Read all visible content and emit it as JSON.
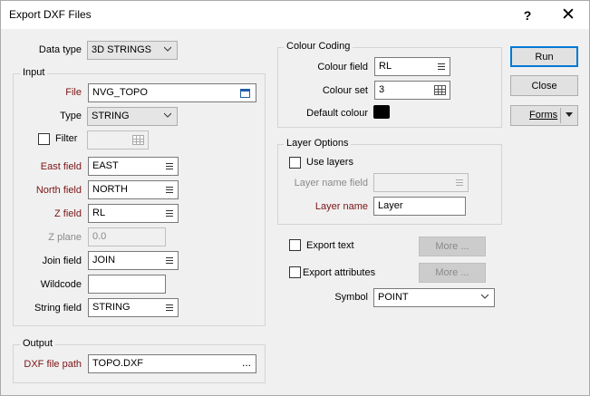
{
  "window": {
    "title": "Export DXF Files",
    "help": "?",
    "close": "✕"
  },
  "data_type": {
    "label": "Data type",
    "value": "3D STRINGS"
  },
  "input": {
    "title": "Input",
    "file": {
      "label": "File",
      "value": "NVG_TOPO"
    },
    "type": {
      "label": "Type",
      "value": "STRING"
    },
    "filter": {
      "label": "Filter",
      "value": ""
    },
    "east_field": {
      "label": "East field",
      "value": "EAST"
    },
    "north_field": {
      "label": "North field",
      "value": "NORTH"
    },
    "z_field": {
      "label": "Z field",
      "value": "RL"
    },
    "z_plane": {
      "label": "Z plane",
      "value": "0.0"
    },
    "join_field": {
      "label": "Join field",
      "value": "JOIN"
    },
    "wildcode": {
      "label": "Wildcode",
      "value": ""
    },
    "string_field": {
      "label": "String field",
      "value": "STRING"
    }
  },
  "output": {
    "title": "Output",
    "dxf_file_path": {
      "label": "DXF file path",
      "value": "TOPO.DXF",
      "browse": "..."
    }
  },
  "colour_coding": {
    "title": "Colour Coding",
    "colour_field": {
      "label": "Colour field",
      "value": "RL"
    },
    "colour_set": {
      "label": "Colour set",
      "value": "3"
    },
    "default_colour": {
      "label": "Default colour",
      "color": "#000000"
    }
  },
  "layer_options": {
    "title": "Layer Options",
    "use_layers": "Use layers",
    "layer_name_field": {
      "label": "Layer name field",
      "value": ""
    },
    "layer_name": {
      "label": "Layer name",
      "value": "Layer"
    }
  },
  "export_text": {
    "label": "Export text",
    "more": "More ..."
  },
  "export_attributes": {
    "label": "Export attributes",
    "more": "More ..."
  },
  "symbol": {
    "label": "Symbol",
    "value": "POINT"
  },
  "buttons": {
    "run": "Run",
    "close": "Close",
    "forms": "Forms"
  }
}
